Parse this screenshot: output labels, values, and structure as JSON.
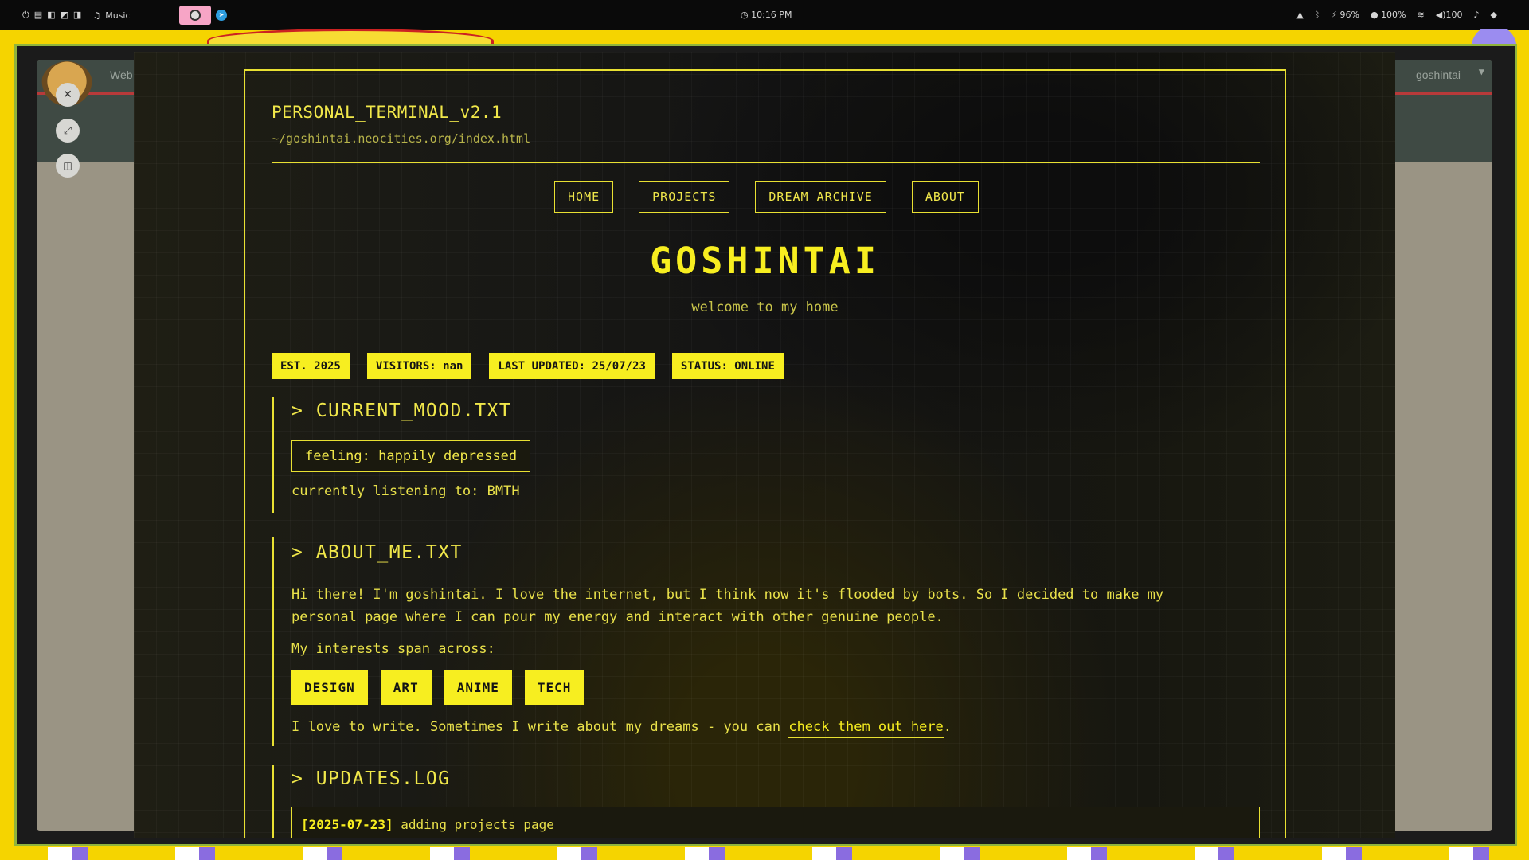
{
  "topbar": {
    "left_glyphs": [
      "⏻",
      "▤",
      "◧",
      "◩",
      "◨"
    ],
    "music_label": "Music",
    "clock": "10:16 PM",
    "status": {
      "wifi_battery": "96%",
      "brightness": "100%",
      "volume": "100"
    }
  },
  "background_browser": {
    "site_label": "Web",
    "user_label": "goshintai"
  },
  "terminal": {
    "title": "PERSONAL_TERMINAL_v2.1",
    "path": "~/goshintai.neocities.org/index.html"
  },
  "nav": {
    "items": [
      {
        "label": "HOME"
      },
      {
        "label": "PROJECTS"
      },
      {
        "label": "DREAM ARCHIVE"
      },
      {
        "label": "ABOUT"
      }
    ]
  },
  "hero": {
    "site_name": "GOSHINTAI",
    "welcome": "welcome to my home"
  },
  "badges": [
    "EST. 2025",
    "VISITORS: nan",
    "LAST UPDATED: 25/07/23",
    "STATUS: ONLINE"
  ],
  "mood": {
    "title": "> CURRENT_MOOD.TXT",
    "feeling": "feeling: happily depressed",
    "listening": "currently listening to: BMTH"
  },
  "about": {
    "title": "> ABOUT_ME.TXT",
    "paragraph": "Hi there! I'm goshintai. I love the internet, but I think now it's flooded by bots. So I decided to make my personal page where I can pour my energy and interact with other genuine people.",
    "interests_intro": "My interests span across:",
    "tags": [
      "DESIGN",
      "ART",
      "ANIME",
      "TECH"
    ],
    "write_text": "I love to write. Sometimes I write about my dreams - you can ",
    "write_link": "check them out here",
    "write_end": "."
  },
  "updates": {
    "title": "> UPDATES.LOG",
    "entries": [
      {
        "date": "[2025-07-23]",
        "text": " adding projects page"
      }
    ]
  },
  "colors": {
    "accent": "#f7ee20",
    "frame": "#e8e032",
    "page_bg": "#141414",
    "desktop": "#f5d400"
  },
  "icons": {
    "close": "close-icon",
    "expand": "expand-icon",
    "split": "split-view-icon"
  }
}
